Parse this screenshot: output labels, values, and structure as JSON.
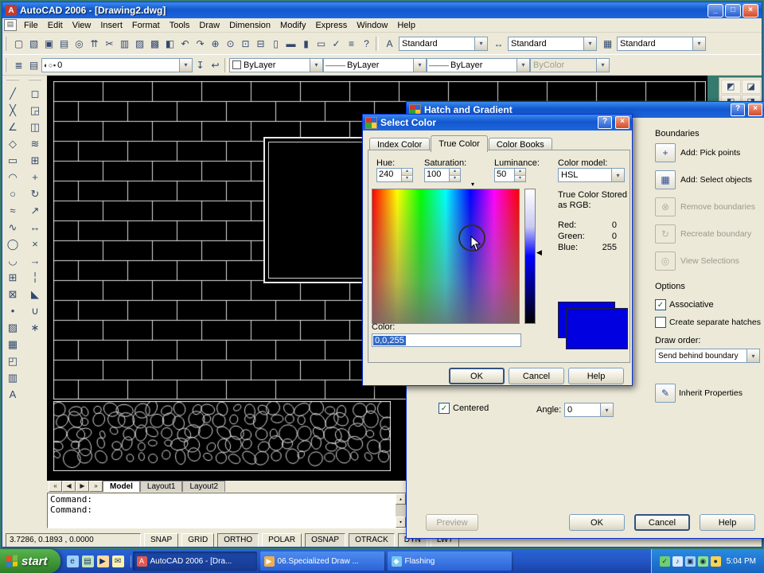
{
  "colors": {
    "desktop_teal": "#35796f",
    "titlebar_blue": "#1257ce",
    "selected_color": "#0000e0",
    "selection_highlight": "#316ac5"
  },
  "icons": {
    "check": "✓",
    "dropdown": "▾",
    "spin_up": "▴",
    "spin_down": "▾",
    "slider_marker": "◀",
    "hue_marker": "▾",
    "scroll_up": "▴",
    "scroll_down": "▾"
  },
  "window": {
    "title": "AutoCAD 2006 - [Drawing2.dwg]",
    "app_icon_glyph": "A",
    "drawing_icon_glyph": "▤",
    "controls": {
      "minimize": "_",
      "restore": "□",
      "close": "×"
    }
  },
  "menus": [
    {
      "name": "menu-file",
      "label": "File"
    },
    {
      "name": "menu-edit",
      "label": "Edit"
    },
    {
      "name": "menu-view",
      "label": "View"
    },
    {
      "name": "menu-insert",
      "label": "Insert"
    },
    {
      "name": "menu-format",
      "label": "Format"
    },
    {
      "name": "menu-tools",
      "label": "Tools"
    },
    {
      "name": "menu-draw",
      "label": "Draw"
    },
    {
      "name": "menu-dimension",
      "label": "Dimension"
    },
    {
      "name": "menu-modify",
      "label": "Modify"
    },
    {
      "name": "menu-express",
      "label": "Express"
    },
    {
      "name": "menu-window",
      "label": "Window"
    },
    {
      "name": "menu-help",
      "label": "Help"
    }
  ],
  "standard_toolbar": [
    {
      "name": "new-icon",
      "glyph": "▢"
    },
    {
      "name": "open-icon",
      "glyph": "▧"
    },
    {
      "name": "save-icon",
      "glyph": "▣"
    },
    {
      "name": "plot-icon",
      "glyph": "▤"
    },
    {
      "name": "plot-preview-icon",
      "glyph": "◎"
    },
    {
      "name": "publish-icon",
      "glyph": "⇈"
    },
    {
      "name": "cut-icon",
      "glyph": "✂"
    },
    {
      "name": "copy-icon",
      "glyph": "▥"
    },
    {
      "name": "paste-icon",
      "glyph": "▨"
    },
    {
      "name": "match-properties-icon",
      "glyph": "▩"
    },
    {
      "name": "block-editor-icon",
      "glyph": "◧"
    },
    {
      "name": "undo-icon",
      "glyph": "↶"
    },
    {
      "name": "redo-icon",
      "glyph": "↷"
    },
    {
      "name": "pan-icon",
      "glyph": "⊕"
    },
    {
      "name": "zoom-realtime-icon",
      "glyph": "⊙"
    },
    {
      "name": "zoom-window-icon",
      "glyph": "⊡"
    },
    {
      "name": "zoom-previous-icon",
      "glyph": "⊟"
    },
    {
      "name": "properties-icon",
      "glyph": "▯"
    },
    {
      "name": "designcenter-icon",
      "glyph": "▬"
    },
    {
      "name": "tool-palettes-icon",
      "glyph": "▮"
    },
    {
      "name": "sheet-set-manager-icon",
      "glyph": "▭"
    },
    {
      "name": "markup-set-manager-icon",
      "glyph": "✓"
    },
    {
      "name": "quickcalc-icon",
      "glyph": "≡"
    },
    {
      "name": "help-icon",
      "glyph": "?"
    }
  ],
  "style_toolbar": {
    "combos": [
      {
        "name": "text-style-combo",
        "icon": "text-style-icon",
        "glyph": "A",
        "value": "Standard"
      },
      {
        "name": "dim-style-combo",
        "icon": "dim-style-icon",
        "glyph": "↔",
        "value": "Standard"
      },
      {
        "name": "table-style-combo",
        "icon": "table-style-icon",
        "glyph": "▦",
        "value": "Standard"
      }
    ]
  },
  "layers_toolbar": {
    "pre_icons": [
      {
        "name": "layer-properties-manager-icon",
        "glyph": "≣"
      },
      {
        "name": "layer-states-manager-icon",
        "glyph": "▤"
      }
    ],
    "layer_combo": {
      "state_glyphs": "◐ ○ ▪",
      "value": "0"
    },
    "post_icons": [
      {
        "name": "make-object-layer-current-icon",
        "glyph": "↧"
      },
      {
        "name": "layer-previous-icon",
        "glyph": "↩"
      }
    ]
  },
  "properties_toolbar": {
    "color_combo": {
      "value": "ByLayer",
      "swatch_style": "background:#ffffff"
    },
    "linetype_combo": {
      "value": "ByLayer",
      "sample": "———"
    },
    "lineweight_combo": {
      "value": "ByLayer",
      "sample": "———"
    },
    "plotstyle_combo": {
      "value": "ByColor",
      "disabled": true
    }
  },
  "right_dock_icons": [
    {
      "name": "draw-order-bring-to-front-icon",
      "glyph": "◩"
    },
    {
      "name": "draw-order-send-to-back-icon",
      "glyph": "◪"
    },
    {
      "name": "draw-order-bring-above-icon",
      "glyph": "◧"
    },
    {
      "name": "draw-order-send-under-icon",
      "glyph": "◨"
    }
  ],
  "draw_toolbar": [
    {
      "name": "line-icon",
      "glyph": "╱"
    },
    {
      "name": "construction-line-icon",
      "glyph": "╳"
    },
    {
      "name": "polyline-icon",
      "glyph": "∠"
    },
    {
      "name": "polygon-icon",
      "glyph": "◇"
    },
    {
      "name": "rectangle-icon",
      "glyph": "▭"
    },
    {
      "name": "arc-icon",
      "glyph": "◠"
    },
    {
      "name": "circle-icon",
      "glyph": "○"
    },
    {
      "name": "revision-cloud-icon",
      "glyph": "≈"
    },
    {
      "name": "spline-icon",
      "glyph": "∿"
    },
    {
      "name": "ellipse-icon",
      "glyph": "◯"
    },
    {
      "name": "ellipse-arc-icon",
      "glyph": "◡"
    },
    {
      "name": "insert-block-icon",
      "glyph": "⊞"
    },
    {
      "name": "make-block-icon",
      "glyph": "⊠"
    },
    {
      "name": "point-icon",
      "glyph": "•"
    },
    {
      "name": "hatch-icon",
      "glyph": "▨"
    },
    {
      "name": "gradient-icon",
      "glyph": "▦"
    },
    {
      "name": "region-icon",
      "glyph": "◰"
    },
    {
      "name": "table-icon",
      "glyph": "▥"
    },
    {
      "name": "multiline-text-icon",
      "glyph": "A"
    }
  ],
  "modify_toolbar": [
    {
      "name": "erase-icon",
      "glyph": "◻"
    },
    {
      "name": "copy-object-icon",
      "glyph": "◲"
    },
    {
      "name": "mirror-icon",
      "glyph": "◫"
    },
    {
      "name": "offset-icon",
      "glyph": "≋"
    },
    {
      "name": "array-icon",
      "glyph": "⊞"
    },
    {
      "name": "move-icon",
      "glyph": "+"
    },
    {
      "name": "rotate-icon",
      "glyph": "↻"
    },
    {
      "name": "scale-icon",
      "glyph": "↗"
    },
    {
      "name": "stretch-icon",
      "glyph": "↔"
    },
    {
      "name": "trim-icon",
      "glyph": "×"
    },
    {
      "name": "extend-icon",
      "glyph": "→"
    },
    {
      "name": "break-icon",
      "glyph": "╎"
    },
    {
      "name": "chamfer-icon",
      "glyph": "◣"
    },
    {
      "name": "fillet-icon",
      "glyph": "∪"
    },
    {
      "name": "explode-icon",
      "glyph": "∗"
    }
  ],
  "hatch_dialog": {
    "title": "Hatch and Gradient",
    "help_glyph": "?",
    "close_glyph": "×",
    "boundaries_label": "Boundaries",
    "boundary_items": [
      {
        "name": "add-pick-points-button",
        "icon": "pick-points-icon",
        "glyph": "+",
        "label": "Add: Pick points",
        "disabled": false
      },
      {
        "name": "add-select-objects-button",
        "icon": "select-objects-icon",
        "glyph": "▦",
        "label": "Add: Select objects",
        "disabled": false
      },
      {
        "name": "remove-boundaries-button",
        "icon": "remove-boundaries-icon",
        "glyph": "⊗",
        "label": "Remove boundaries",
        "disabled": true
      },
      {
        "name": "recreate-boundary-button",
        "icon": "recreate-boundary-icon",
        "glyph": "↻",
        "label": "Recreate boundary",
        "disabled": true
      },
      {
        "name": "view-selections-button",
        "icon": "view-selections-icon",
        "glyph": "◎",
        "label": "View Selections",
        "disabled": true
      }
    ],
    "options_label": "Options",
    "associative": {
      "label": "Associative",
      "checked": true
    },
    "separate_hatches": {
      "label": "Create separate hatches",
      "checked": false
    },
    "draw_order_label": "Draw order:",
    "draw_order_value": "Send behind boundary",
    "inherit_label": "Inherit Properties",
    "inherit_glyph": "✎",
    "centered": {
      "label": "Centered",
      "checked": true
    },
    "angle_label": "Angle:",
    "angle_value": "0",
    "buttons": {
      "preview": "Preview",
      "ok": "OK",
      "cancel": "Cancel",
      "help": "Help"
    }
  },
  "select_color_dialog": {
    "title": "Select Color",
    "help_glyph": "?",
    "close_glyph": "×",
    "tabs": [
      {
        "name": "tab-index-color",
        "label": "Index Color",
        "active": false
      },
      {
        "name": "tab-true-color",
        "label": "True Color",
        "active": true
      },
      {
        "name": "tab-color-books",
        "label": "Color Books",
        "active": false
      }
    ],
    "hue_label": "Hue:",
    "hue_value": "240",
    "saturation_label": "Saturation:",
    "saturation_value": "100",
    "luminance_label": "Luminance:",
    "luminance_value": "50",
    "color_model_label": "Color model:",
    "color_model_value": "HSL",
    "stored_line1": "True Color Stored",
    "stored_line2": "as RGB:",
    "red_label": "Red:",
    "red_value": "0",
    "green_label": "Green:",
    "green_value": "0",
    "blue_label": "Blue:",
    "blue_value": "255",
    "color_label": "Color:",
    "color_value": "0,0,255",
    "swatch_style": "background:#0000e0",
    "buttons": {
      "ok": "OK",
      "cancel": "Cancel",
      "help": "Help"
    }
  },
  "model_tabs": {
    "nav": [
      {
        "name": "first-layout-button",
        "glyph": "«"
      },
      {
        "name": "prev-layout-button",
        "glyph": "◀"
      },
      {
        "name": "next-layout-button",
        "glyph": "▶"
      },
      {
        "name": "last-layout-button",
        "glyph": "»"
      }
    ],
    "tabs": [
      {
        "name": "tab-model",
        "label": "Model",
        "active": true
      },
      {
        "name": "tab-layout1",
        "label": "Layout1",
        "active": false
      },
      {
        "name": "tab-layout2",
        "label": "Layout2",
        "active": false
      }
    ]
  },
  "command_window": {
    "history": [
      "Command:"
    ],
    "prompt": "Command:"
  },
  "status_bar": {
    "coordinates": "3.7286, 0.1893 , 0.0000",
    "toggles": [
      {
        "name": "toggle-snap",
        "label": "SNAP",
        "pressed": false
      },
      {
        "name": "toggle-grid",
        "label": "GRID",
        "pressed": false
      },
      {
        "name": "toggle-ortho",
        "label": "ORTHO",
        "pressed": true
      },
      {
        "name": "toggle-polar",
        "label": "POLAR",
        "pressed": false
      },
      {
        "name": "toggle-osnap",
        "label": "OSNAP",
        "pressed": true
      },
      {
        "name": "toggle-otrack",
        "label": "OTRACK",
        "pressed": true
      },
      {
        "name": "toggle-dyn",
        "label": "DYN",
        "pressed": true
      },
      {
        "name": "toggle-lwt",
        "label": "LWT",
        "pressed": false
      }
    ]
  },
  "taskbar": {
    "start_label": "start",
    "quick_launch": [
      {
        "name": "internet-explorer-icon",
        "glyph": "e",
        "color": "#9ed0ff"
      },
      {
        "name": "show-desktop-icon",
        "glyph": "▤",
        "color": "#bfe3bf"
      },
      {
        "name": "media-player-icon",
        "glyph": "▶",
        "color": "#ffd9a0"
      },
      {
        "name": "email-icon",
        "glyph": "✉",
        "color": "#fff2b0"
      }
    ],
    "tasks": [
      {
        "name": "task-autocad",
        "label": "AutoCAD 2006 - [Dra...",
        "icon_glyph": "A",
        "icon_color": "#e05a4e",
        "active": true
      },
      {
        "name": "task-specialized-draw",
        "label": "06.Specialized Draw ...",
        "icon_glyph": "▶",
        "icon_color": "#f0b052",
        "active": false
      },
      {
        "name": "task-flashing",
        "label": "Flashing",
        "icon_glyph": "◆",
        "icon_color": "#79c9ef",
        "active": false
      }
    ],
    "tray_icons": [
      {
        "name": "antivirus-icon",
        "glyph": "✓",
        "color": "#6fcf6f"
      },
      {
        "name": "volume-icon",
        "glyph": "♪",
        "color": "#d6e9ff"
      },
      {
        "name": "network-icon",
        "glyph": "▣",
        "color": "#a9d3ff"
      },
      {
        "name": "messenger-icon",
        "glyph": "◉",
        "color": "#8de08d"
      },
      {
        "name": "update-icon",
        "glyph": "●",
        "color": "#ffd24d"
      }
    ],
    "time": "5:04 PM"
  }
}
